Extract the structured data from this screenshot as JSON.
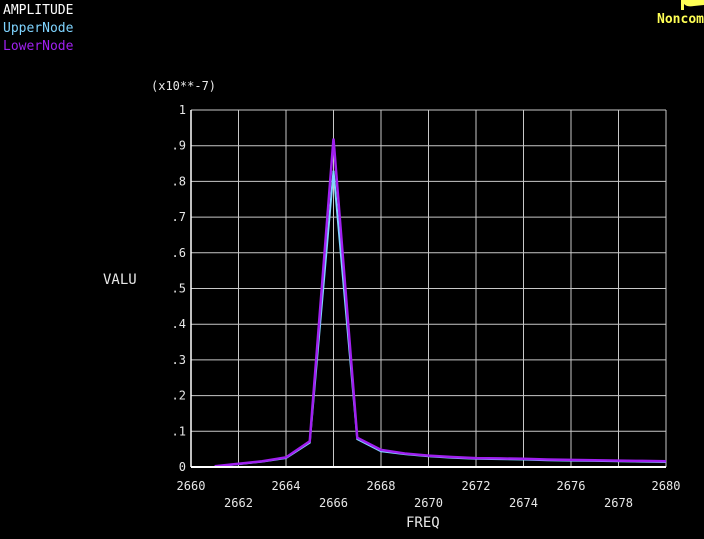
{
  "legend": {
    "title": "AMPLITUDE",
    "upper": "UpperNode",
    "lower": "LowerNode"
  },
  "logo": {
    "text": "Noncom"
  },
  "colors": {
    "background": "#000000",
    "grid": "#c8c8c8",
    "text": "#e8e8e8",
    "upper": "#7fd4ff",
    "lower": "#a020f0",
    "logo": "#ffff55"
  },
  "chart_data": {
    "type": "line",
    "exponent_label": "(x10**-7)",
    "xlabel": "FREQ",
    "ylabel": "VALU",
    "xlim": [
      2660,
      2680
    ],
    "ylim": [
      0,
      1
    ],
    "x_ticks": [
      "2660",
      "2662",
      "2664",
      "2666",
      "2668",
      "2670",
      "2672",
      "2674",
      "2676",
      "2678",
      "2680"
    ],
    "y_ticks": [
      "0",
      ".1",
      ".2",
      ".3",
      ".4",
      ".5",
      ".6",
      ".7",
      ".8",
      ".9",
      "1"
    ],
    "grid": true,
    "x": [
      2661,
      2662,
      2663,
      2664,
      2665,
      2666,
      2667,
      2668,
      2669,
      2670,
      2671,
      2672,
      2673,
      2674,
      2675,
      2676,
      2677,
      2678,
      2679,
      2680
    ],
    "series": [
      {
        "name": "UpperNode",
        "color": "#7fd4ff",
        "values": [
          0.002,
          0.008,
          0.015,
          0.025,
          0.068,
          0.83,
          0.078,
          0.044,
          0.036,
          0.03,
          0.026,
          0.023,
          0.022,
          0.021,
          0.019,
          0.018,
          0.017,
          0.016,
          0.015,
          0.014
        ]
      },
      {
        "name": "LowerNode",
        "color": "#a020f0",
        "values": [
          0.002,
          0.009,
          0.016,
          0.027,
          0.072,
          0.92,
          0.082,
          0.048,
          0.038,
          0.032,
          0.028,
          0.025,
          0.024,
          0.023,
          0.021,
          0.02,
          0.019,
          0.018,
          0.017,
          0.016
        ]
      }
    ]
  }
}
